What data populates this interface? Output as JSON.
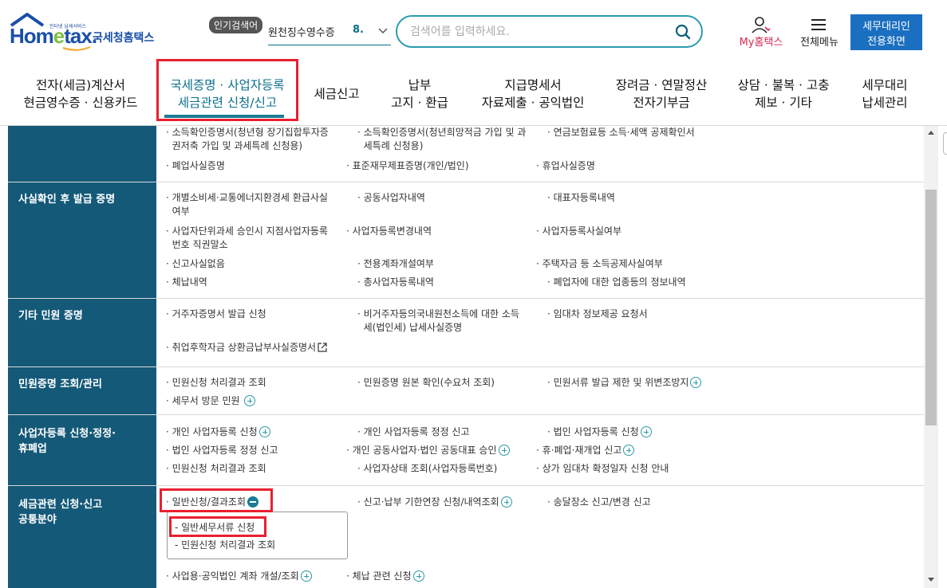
{
  "header": {
    "logo": {
      "small_text": "인터넷 납세서비스",
      "word_pre": "Hom",
      "word_e": "e",
      "word_post": "tax.",
      "korean": "국세청홈택스"
    },
    "popular": {
      "badge": "인기검색어",
      "item": "원천징수영수증",
      "rank": "8."
    },
    "search": {
      "placeholder": "검색어를 입력하세요."
    },
    "myhome_label": "My홈택스",
    "allmenu_label": "전체메뉴",
    "agent_button": {
      "line1": "세무대리인",
      "line2": "전용화면"
    }
  },
  "nav": [
    {
      "line1": "전자(세금)계산서",
      "line2": "현금영수증 · 신용카드"
    },
    {
      "line1": "국세증명 · 사업자등록",
      "line2": "세금관련 신청/신고"
    },
    {
      "line1": "세금신고",
      "line2": ""
    },
    {
      "line1": "납부",
      "line2": "고지 · 환급"
    },
    {
      "line1": "지급명세서",
      "line2": "자료제출 · 공익법인"
    },
    {
      "line1": "장려금 · 연말정산",
      "line2": "전자기부금"
    },
    {
      "line1": "상담 · 불복 · 고충",
      "line2": "제보 · 기타"
    },
    {
      "line1": "세무대리",
      "line2": "납세관리"
    }
  ],
  "sections": [
    {
      "title": "",
      "items": [
        [
          "· 소득확인증명서(청년형 장기집합투자증",
          "권저축 가입 및 과세특례 신청용)"
        ],
        [
          "· 소득확인증명서(청년희망적금 가입 및 과",
          "세특례 신청용)"
        ],
        [
          "· 연금보험료등 소득·세액 공제확인서",
          ""
        ],
        [
          "· 폐업사실증명",
          ""
        ],
        [
          "· 표준재무제표증명(개인/법인)",
          ""
        ],
        [
          "· 휴업사실증명",
          ""
        ]
      ]
    },
    {
      "title": "사실확인 후 발급 증명",
      "items": [
        [
          "· 개별소비세·교통에너지환경세 환급사실",
          "여부"
        ],
        [
          "· 공동사업자내역",
          ""
        ],
        [
          "· 대표자등록내역",
          ""
        ],
        [
          "· 사업자단위과세 승인시 지점사업자등록",
          "번호 직권말소"
        ],
        [
          "· 사업자등록변경내역",
          ""
        ],
        [
          "· 사업자등록사실여부",
          ""
        ],
        [
          "· 신고사실없음",
          ""
        ],
        [
          "· 전용계좌개설여부",
          ""
        ],
        [
          "· 주택자금 등 소득공제사실여부",
          ""
        ],
        [
          "· 체납내역",
          ""
        ],
        [
          "· 총사업자등록내역",
          ""
        ],
        [
          "· 폐업자에 대한 업종등의 정보내역",
          ""
        ]
      ]
    },
    {
      "title": "기타 민원 증명",
      "items": [
        [
          "· 거주자증명서 발급 신청",
          ""
        ],
        [
          "· 비거주자등의국내원천소득에 대한 소득",
          "세(법인세) 납세사실증명"
        ],
        [
          "· 임대차 정보제공 요청서",
          ""
        ],
        [
          "· 취업후학자금 상환금납부사실증명서",
          ""
        ]
      ]
    },
    {
      "title": "민원증명 조회/관리",
      "items": [
        [
          "· 민원신청 처리결과 조회",
          ""
        ],
        [
          "· 민원증명 원본 확인(수요처 조회)",
          ""
        ],
        [
          "· 민원서류 발급 제한 및 위변조방지",
          ""
        ],
        [
          "· 세무서 방문 민원",
          ""
        ]
      ]
    },
    {
      "title_line1": "사업자등록 신청·정정·",
      "title_line2": "휴폐업",
      "items": [
        [
          "· 개인 사업자등록 신청",
          ""
        ],
        [
          "· 개인 사업자등록 정정 신고",
          ""
        ],
        [
          "· 법인 사업자등록 신청",
          ""
        ],
        [
          "· 법인 사업자등록 정정 신고",
          ""
        ],
        [
          "· 개인 공동사업자·법인 공동대표 승인",
          ""
        ],
        [
          "· 휴·폐업·재개업 신고",
          ""
        ],
        [
          "· 민원신청 처리결과 조회",
          ""
        ],
        [
          "· 사업자상태 조회(사업자등록번호)",
          ""
        ],
        [
          "· 상가 임대차 확정일자 신청 안내",
          ""
        ]
      ]
    },
    {
      "title_line1": "세금관련 신청·신고",
      "title_line2": "공통분야",
      "items": [
        [
          "· 일반신청/결과조회",
          ""
        ],
        [
          "· 신고·납부 기한연장 신청/내역조회",
          ""
        ],
        [
          "· 송달장소 신고/변경 신고",
          ""
        ],
        [
          "· 사업용·공익법인 계좌 개설/조회",
          ""
        ],
        [
          "· 체납 관련 신청",
          ""
        ]
      ],
      "submenu": [
        "- 일반세무서류 신청",
        "- 민원신청 처리결과 조회"
      ]
    }
  ]
}
